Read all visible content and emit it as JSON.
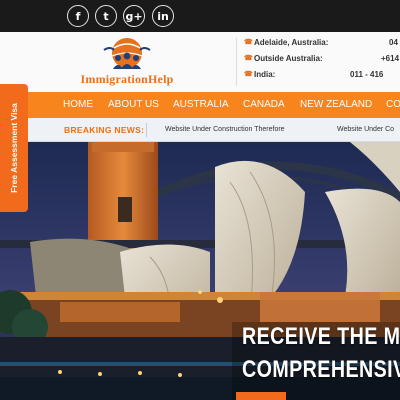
{
  "social": {
    "icons": [
      "facebook-icon",
      "twitter-icon",
      "google-plus-icon",
      "linkedin-icon"
    ],
    "glyphs": [
      "f",
      "t",
      "g+",
      "in"
    ]
  },
  "logo": {
    "text": "ImmigrationHelp"
  },
  "contacts": [
    {
      "label": "Adelaide, Australia:",
      "value": "04"
    },
    {
      "label": "Outside Australia:",
      "value": "+614"
    },
    {
      "label": "India:",
      "value": "011 - 416"
    }
  ],
  "nav": {
    "items": [
      "HOME",
      "ABOUT US",
      "AUSTRALIA",
      "CANADA",
      "NEW ZEALAND",
      "CO"
    ]
  },
  "news": {
    "label": "BREAKING NEWS:",
    "items": [
      "Website Under Construction Therefore",
      "Website Under Co"
    ]
  },
  "hero": {
    "line1": "RECEIVE THE M",
    "line2": "COMPREHENSIV"
  },
  "side_tab": {
    "label": "Free Assessment Visa"
  },
  "colors": {
    "accent": "#f7841d",
    "tab": "#f26a1b",
    "topbar": "#1a1a1a"
  }
}
